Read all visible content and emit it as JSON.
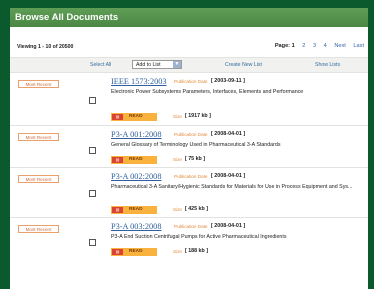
{
  "header": {
    "title": "Browse All Documents"
  },
  "summary": {
    "viewing": "Viewing 1 - 10 of 20500"
  },
  "pagination": {
    "page_label": "Page: 1",
    "pages": [
      "2",
      "3",
      "4"
    ],
    "next": "Next",
    "last": "Last"
  },
  "toolbar": {
    "select_all": "Select All",
    "add_to_list": "Add to List",
    "create_list": "Create New List",
    "show_lists": "Show Lists"
  },
  "documents": [
    {
      "badge": "Most Recent",
      "title": "IEEE 1573:2003",
      "pub_label": "Publication Date",
      "pub_date": "[ 2003-09-11 ]",
      "description": "Electronic Power Subsystems Parameters, Interfaces, Elements and Performance",
      "read_label": "READ",
      "size_label": "Size",
      "size": "[ 1917 kb ]"
    },
    {
      "badge": "Most Recent",
      "title": "P3-A 001:2008",
      "pub_label": "Publication Date",
      "pub_date": "[ 2008-04-01 ]",
      "description": "General Glossary of Terminology Used in Pharmaceutical 3-A Standards",
      "read_label": "READ",
      "size_label": "Size",
      "size": "[ 75 kb ]"
    },
    {
      "badge": "Most Recent",
      "title": "P3-A 002:2008",
      "pub_label": "Publication Date",
      "pub_date": "[ 2008-04-01 ]",
      "description": "Pharmaceutical 3-A Sanitary/Hygienic Standards for Materials for Use in Process Equipment and Sys...",
      "read_label": "READ",
      "size_label": "Size",
      "size": "[ 425 kb ]"
    },
    {
      "badge": "Most Recent",
      "title": "P3-A 003:2008",
      "pub_label": "Publication Date",
      "pub_date": "[ 2008-04-01 ]",
      "description": "P3-A End Suction Centrifugal Pumps for Active Pharmaceutical Ingredients",
      "read_label": "READ",
      "size_label": "Size",
      "size": "[ 188 kb ]"
    }
  ],
  "colors": {
    "background": "#0a5a2e",
    "header": "#4a8744",
    "link": "#2f5f9e",
    "label": "#e28a38",
    "read_button": "#f8b23d"
  },
  "icons": {
    "read": "document-read-icon",
    "dropdown": "chevron-down-icon"
  }
}
